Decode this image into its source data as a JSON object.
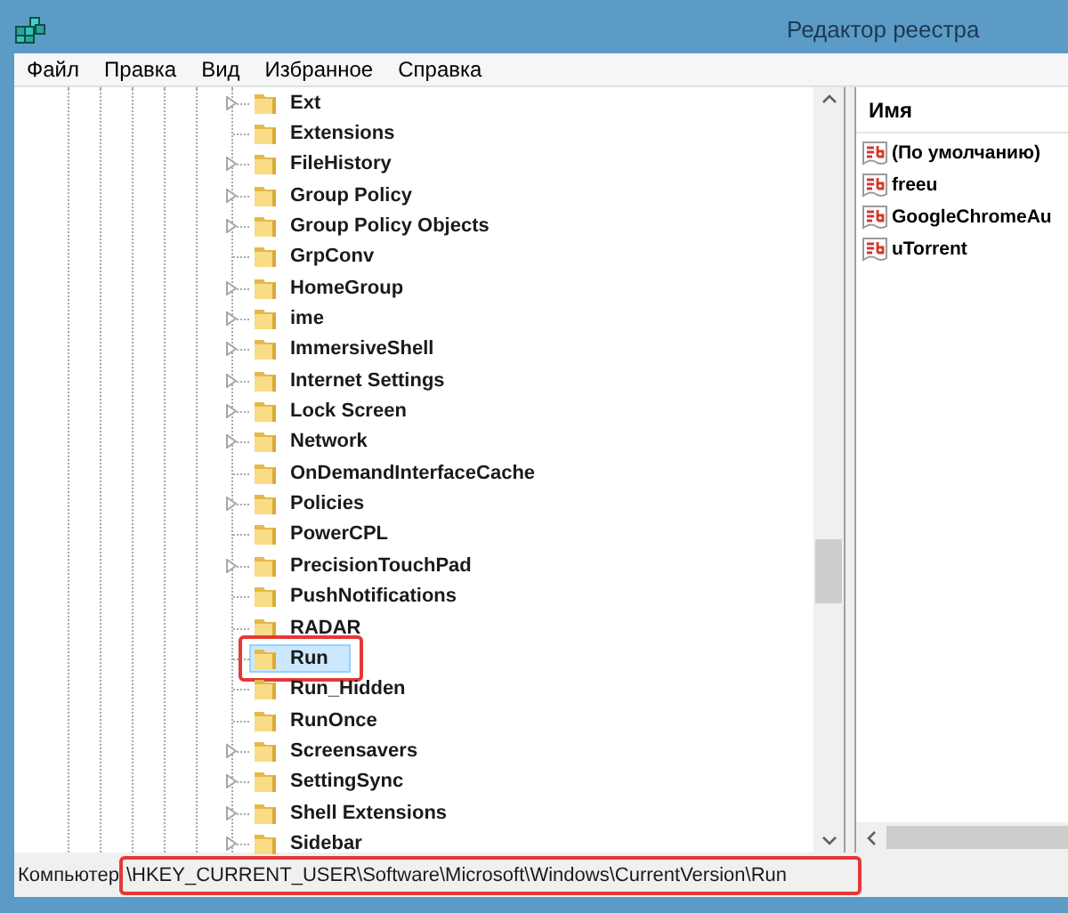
{
  "window": {
    "title": "Редактор реестра"
  },
  "menu": [
    "Файл",
    "Правка",
    "Вид",
    "Избранное",
    "Справка"
  ],
  "tree": {
    "items": [
      {
        "label": "Ext",
        "expandable": true,
        "selected": false,
        "annotated": false
      },
      {
        "label": "Extensions",
        "expandable": false,
        "selected": false,
        "annotated": false
      },
      {
        "label": "FileHistory",
        "expandable": true,
        "selected": false,
        "annotated": false
      },
      {
        "label": "Group Policy",
        "expandable": true,
        "selected": false,
        "annotated": false
      },
      {
        "label": "Group Policy Objects",
        "expandable": true,
        "selected": false,
        "annotated": false
      },
      {
        "label": "GrpConv",
        "expandable": false,
        "selected": false,
        "annotated": false
      },
      {
        "label": "HomeGroup",
        "expandable": true,
        "selected": false,
        "annotated": false
      },
      {
        "label": "ime",
        "expandable": true,
        "selected": false,
        "annotated": false
      },
      {
        "label": "ImmersiveShell",
        "expandable": true,
        "selected": false,
        "annotated": false
      },
      {
        "label": "Internet Settings",
        "expandable": true,
        "selected": false,
        "annotated": false
      },
      {
        "label": "Lock Screen",
        "expandable": true,
        "selected": false,
        "annotated": false
      },
      {
        "label": "Network",
        "expandable": true,
        "selected": false,
        "annotated": false
      },
      {
        "label": "OnDemandInterfaceCache",
        "expandable": false,
        "selected": false,
        "annotated": false
      },
      {
        "label": "Policies",
        "expandable": true,
        "selected": false,
        "annotated": false
      },
      {
        "label": "PowerCPL",
        "expandable": false,
        "selected": false,
        "annotated": false
      },
      {
        "label": "PrecisionTouchPad",
        "expandable": true,
        "selected": false,
        "annotated": false
      },
      {
        "label": "PushNotifications",
        "expandable": false,
        "selected": false,
        "annotated": false
      },
      {
        "label": "RADAR",
        "expandable": false,
        "selected": false,
        "annotated": false
      },
      {
        "label": "Run",
        "expandable": false,
        "selected": true,
        "annotated": true
      },
      {
        "label": "Run_Hidden",
        "expandable": false,
        "selected": false,
        "annotated": false
      },
      {
        "label": "RunOnce",
        "expandable": false,
        "selected": false,
        "annotated": false
      },
      {
        "label": "Screensavers",
        "expandable": true,
        "selected": false,
        "annotated": false
      },
      {
        "label": "SettingSync",
        "expandable": true,
        "selected": false,
        "annotated": false
      },
      {
        "label": "Shell Extensions",
        "expandable": true,
        "selected": false,
        "annotated": false
      },
      {
        "label": "Sidebar",
        "expandable": true,
        "selected": false,
        "annotated": false
      }
    ]
  },
  "values": {
    "column": "Имя",
    "rows": [
      "(По умолчанию)",
      "freeu",
      "GoogleChromeAu",
      "uTorrent"
    ]
  },
  "status_bar": {
    "prefix": "Компьютер",
    "path": "\\HKEY_CURRENT_USER\\Software\\Microsoft\\Windows\\CurrentVersion\\Run",
    "path_annotated": true
  }
}
